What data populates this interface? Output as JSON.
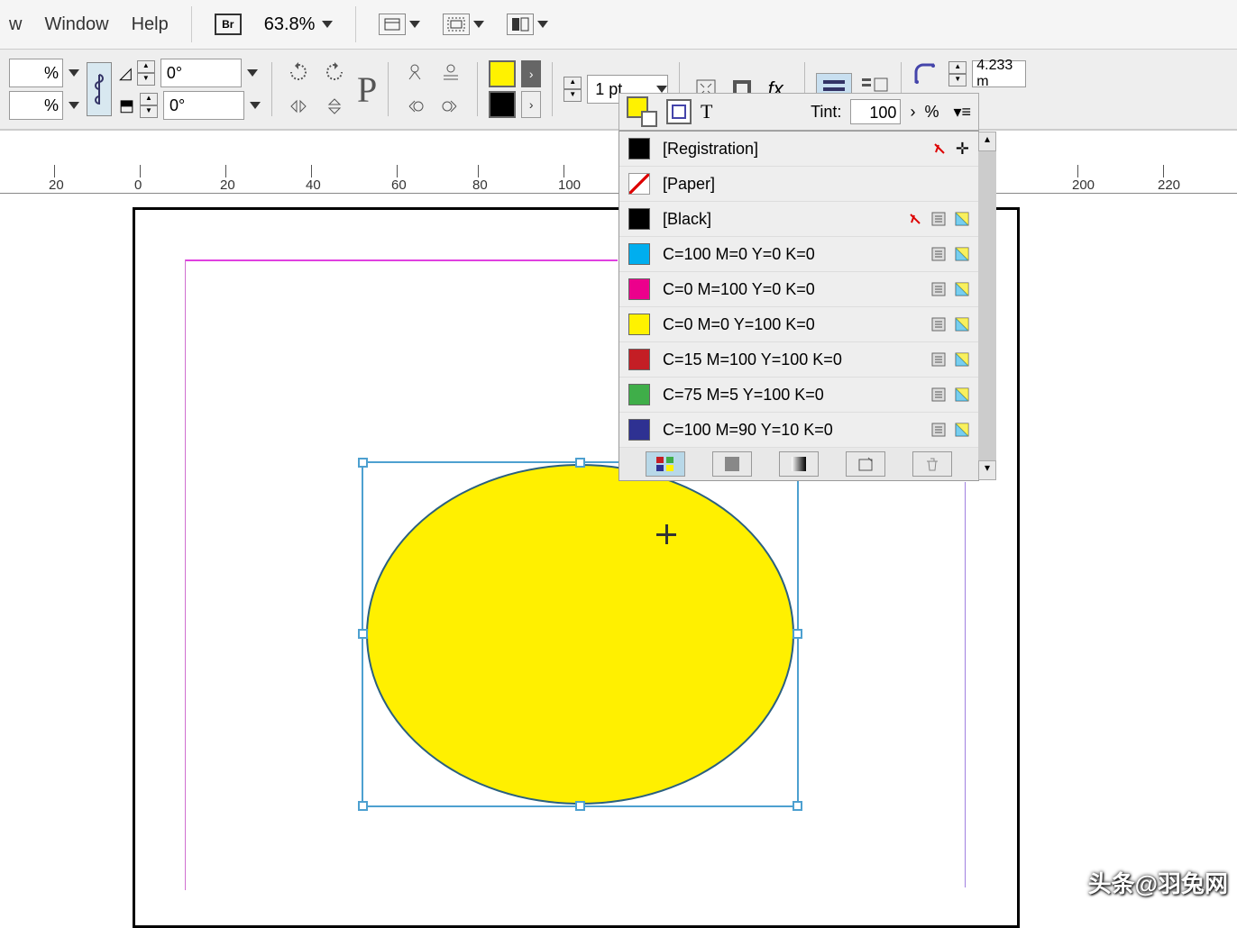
{
  "menu": {
    "view": "w",
    "window": "Window",
    "help": "Help",
    "zoom": "63.8%"
  },
  "toolbar": {
    "scale_x_unit": "%",
    "scale_y_unit": "%",
    "angle_top": "0°",
    "angle_bottom": "0°",
    "stroke_weight": "1 pt",
    "coord_x": "4.233 m"
  },
  "sub": {
    "tint_label": "Tint:",
    "tint_value": "100",
    "pct": "%"
  },
  "swatches": [
    {
      "name": "[Registration]",
      "color": "#000000",
      "lock": true,
      "target": true
    },
    {
      "name": "[Paper]",
      "color": "paper"
    },
    {
      "name": "[Black]",
      "color": "#000000",
      "lock": true,
      "proc": true,
      "cmyk": true
    },
    {
      "name": "C=100 M=0 Y=0 K=0",
      "color": "#00aeef",
      "proc": true,
      "cmyk": true
    },
    {
      "name": "C=0 M=100 Y=0 K=0",
      "color": "#ec008c",
      "proc": true,
      "cmyk": true
    },
    {
      "name": "C=0 M=0 Y=100 K=0",
      "color": "#fff200",
      "proc": true,
      "cmyk": true
    },
    {
      "name": "C=15 M=100 Y=100 K=0",
      "color": "#c41e25",
      "proc": true,
      "cmyk": true
    },
    {
      "name": "C=75 M=5 Y=100 K=0",
      "color": "#3fae49",
      "proc": true,
      "cmyk": true
    },
    {
      "name": "C=100 M=90 Y=10 K=0",
      "color": "#2e3192",
      "proc": true,
      "cmyk": true
    }
  ],
  "ruler": [
    "20",
    "0",
    "20",
    "40",
    "60",
    "80",
    "100",
    "200",
    "220"
  ],
  "watermark": "头条@羽兔网"
}
